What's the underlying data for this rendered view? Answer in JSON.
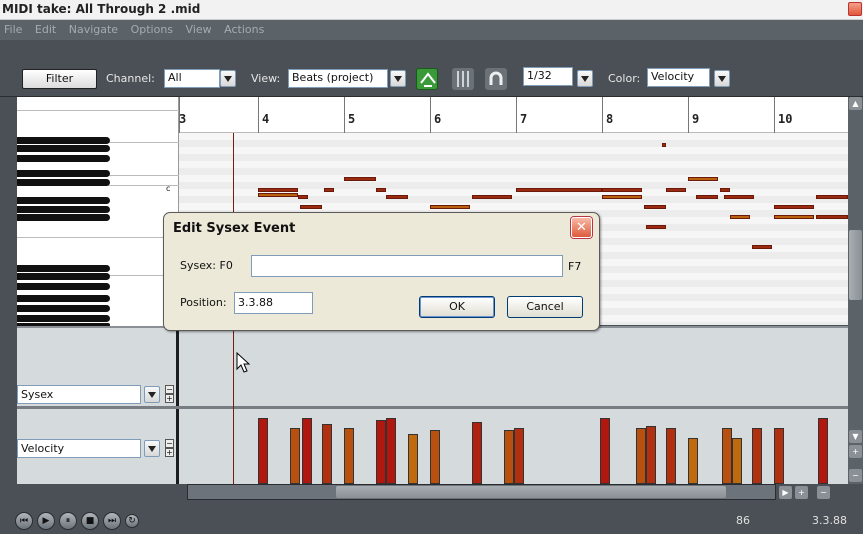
{
  "window": {
    "title": "MIDI take: All Through 2 .mid"
  },
  "menu": [
    "File",
    "Edit",
    "Navigate",
    "Options",
    "View",
    "Actions"
  ],
  "toolbar": {
    "filter_label": "Filter",
    "channel_label": "Channel:",
    "channel_value": "All",
    "view_label": "View:",
    "view_value": "Beats (project)",
    "grid_value": "1/32",
    "color_label": "Color:",
    "color_value": "Velocity"
  },
  "ruler": {
    "measures": [
      "3",
      "4",
      "5",
      "6",
      "7",
      "8",
      "9",
      "10"
    ]
  },
  "keyboard": {
    "octave_label": "c"
  },
  "lanes": {
    "lane1": "Sysex",
    "lane2": "Velocity"
  },
  "status": {
    "left": "86",
    "right": "3.3.88"
  },
  "dialog": {
    "title": "Edit Sysex Event",
    "sysex_label": "Sysex: F0",
    "sysex_value": "",
    "sysex_suffix": "F7",
    "position_label": "Position:",
    "position_value": "3.3.88",
    "ok_label": "OK",
    "cancel_label": "Cancel",
    "close_symbol": "✕"
  },
  "colors": {
    "accent_green": "#3a9a3a",
    "note_dark": "#9b2a13",
    "note_orange": "#b8620f",
    "velocity_high": "#b0170f"
  }
}
